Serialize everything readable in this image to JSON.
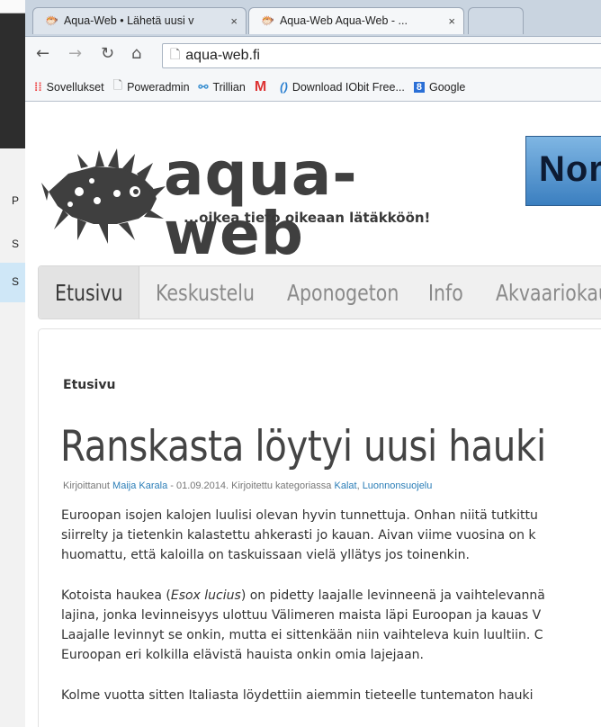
{
  "left_window": {
    "chars": [
      "P",
      "S",
      "S"
    ]
  },
  "browser": {
    "tabs": [
      {
        "title": "Aqua-Web • Lähetä uusi v",
        "active": false
      },
      {
        "title": "Aqua-Web Aqua-Web - ...",
        "active": true
      }
    ],
    "url": "aqua-web.fi",
    "bookmarks": [
      {
        "label": "Sovellukset",
        "icon": "apps-grid-icon"
      },
      {
        "label": "Poweradmin",
        "icon": "page-icon"
      },
      {
        "label": "Trillian",
        "icon": "trillian-icon"
      },
      {
        "label": "",
        "icon": "gmail-icon"
      },
      {
        "label": "Download IObit Free...",
        "icon": "iobit-icon"
      },
      {
        "label": "Google",
        "icon": "google-icon"
      }
    ]
  },
  "site": {
    "brand": "aqua-web",
    "tagline": "...oikea tieto oikeaan lätäkköön!",
    "ad_text": "Nor",
    "nav": [
      "Etusivu",
      "Keskustelu",
      "Aponogeton",
      "Info",
      "Akvaariokau"
    ]
  },
  "article": {
    "breadcrumb": "Etusivu",
    "title": "Ranskasta löytyi uusi hauki",
    "meta": {
      "prefix": "Kirjoittanut",
      "author": "Maija Karala",
      "date_part": " - 01.09.2014. Kirjoitettu kategoriassa",
      "cat1": "Kalat",
      "sep": ",",
      "cat2": "Luonnonsuojelu"
    },
    "p1": [
      "Euroopan isojen kalojen luulisi olevan hyvin tunnettuja. Onhan niitä tutkittu",
      "siirrelty ja tietenkin kalastettu ahkerasti jo kauan. Aivan viime vuosina on k",
      "huomattu, että kaloilla on taskuissaan vielä yllätys jos toinenkin."
    ],
    "p2_line1_a": "Kotoista haukea (",
    "p2_line1_italic": "Esox lucius",
    "p2_line1_b": ") on pidetty laajalle levinneenä ja vaihtelevannä",
    "p2": [
      "lajina, jonka levinneisyys ulottuu Välimeren maista läpi Euroopan ja kauas V",
      "Laajalle levinnyt se onkin, mutta ei sittenkään niin vaihteleva kuin luultiin. C",
      "Euroopan eri kolkilla elävistä hauista onkin omia lajejaan."
    ],
    "p3": [
      "Kolme vuotta sitten Italiasta löydettiin aiemmin tieteelle tuntematon hauki"
    ]
  }
}
